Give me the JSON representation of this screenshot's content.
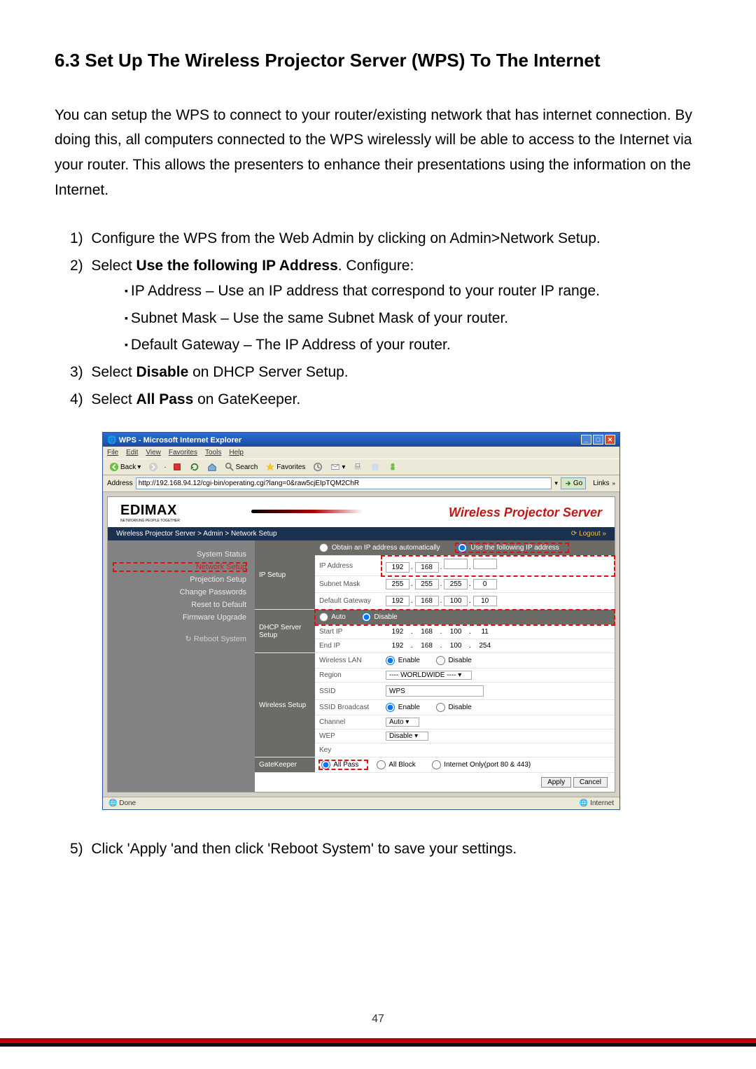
{
  "heading": "6.3 Set Up The Wireless Projector Server (WPS) To The Internet",
  "intro": "You can setup the WPS to connect to your router/existing network that has internet connection. By doing this, all computers connected to the WPS wirelessly will be able to access to the Internet via your router. This allows the presenters to enhance their presentations using the information on the Internet.",
  "steps": {
    "s1": "Configure the WPS from the Web Admin by clicking on Admin>Network Setup.",
    "s2_pre": "Select ",
    "s2_bold": "Use the following IP Address",
    "s2_post": ". Configure:",
    "bul1": "IP Address – Use an IP address that correspond to your router IP range.",
    "bul2": "Subnet Mask – Use the same Subnet Mask of your router.",
    "bul3": "Default Gateway – The IP Address of your router.",
    "s3_pre": "Select ",
    "s3_bold": "Disable",
    "s3_post": " on DHCP Server Setup.",
    "s4_pre": "Select ",
    "s4_bold": "All Pass",
    "s4_post": " on GateKeeper.",
    "s5": "Click 'Apply 'and then click 'Reboot System' to save your settings."
  },
  "browser": {
    "title": "WPS - Microsoft Internet Explorer",
    "menus": [
      "File",
      "Edit",
      "View",
      "Favorites",
      "Tools",
      "Help"
    ],
    "toolbar": {
      "back": "Back",
      "search": "Search",
      "favorites": "Favorites"
    },
    "address_label": "Address",
    "url": "http://192.168.94.12/cgi-bin/operating.cgi?lang=0&raw5cjEIpTQM2ChR",
    "go": "Go",
    "links": "Links",
    "status_left": "Done",
    "status_right": "Internet"
  },
  "page": {
    "logo": "EDIMAX",
    "logo_sub": "NETWORKING PEOPLE TOGETHER",
    "title": "Wireless Projector Server",
    "breadcrumb": "Wireless Projector Server > Admin > Network Setup",
    "logout": "Logout »",
    "nav": {
      "system_status": "System Status",
      "network_setup": "Network Setup",
      "projection_setup": "Projection Setup",
      "change_passwords": "Change Passwords",
      "reset_default": "Reset to Default",
      "firmware_upgrade": "Firmware Upgrade",
      "reboot": "Reboot System"
    },
    "ip_setup": {
      "label": "IP Setup",
      "opt_auto": "Obtain an IP address automatically",
      "opt_manual": "Use the following IP address",
      "ip_label": "IP Address",
      "ip": [
        "192",
        "168",
        "",
        ""
      ],
      "mask_label": "Subnet Mask",
      "mask": [
        "255",
        "255",
        "255",
        "0"
      ],
      "gw_label": "Default Gateway",
      "gw": [
        "192",
        "168",
        "100",
        "10"
      ]
    },
    "dhcp": {
      "label": "DHCP Server Setup",
      "opt_auto": "Auto",
      "opt_disable": "Disable",
      "start_label": "Start IP",
      "start": [
        "192",
        "168",
        "100",
        "11"
      ],
      "end_label": "End IP",
      "end": [
        "192",
        "168",
        "100",
        "254"
      ]
    },
    "wireless": {
      "label": "Wireless Setup",
      "wlan_label": "Wireless LAN",
      "enable": "Enable",
      "disable": "Disable",
      "region_label": "Region",
      "region_val": "---- WORLDWIDE ----",
      "ssid_label": "SSID",
      "ssid_val": "WPS",
      "ssidbc_label": "SSID Broadcast",
      "channel_label": "Channel",
      "channel_val": "Auto",
      "wep_label": "WEP",
      "wep_val": "Disable",
      "key_label": "Key"
    },
    "gatekeeper": {
      "label": "GateKeeper",
      "allpass": "All Pass",
      "allblock": "All Block",
      "internet": "Internet Only(port 80 & 443)"
    },
    "apply": "Apply",
    "cancel": "Cancel"
  },
  "page_number": "47"
}
